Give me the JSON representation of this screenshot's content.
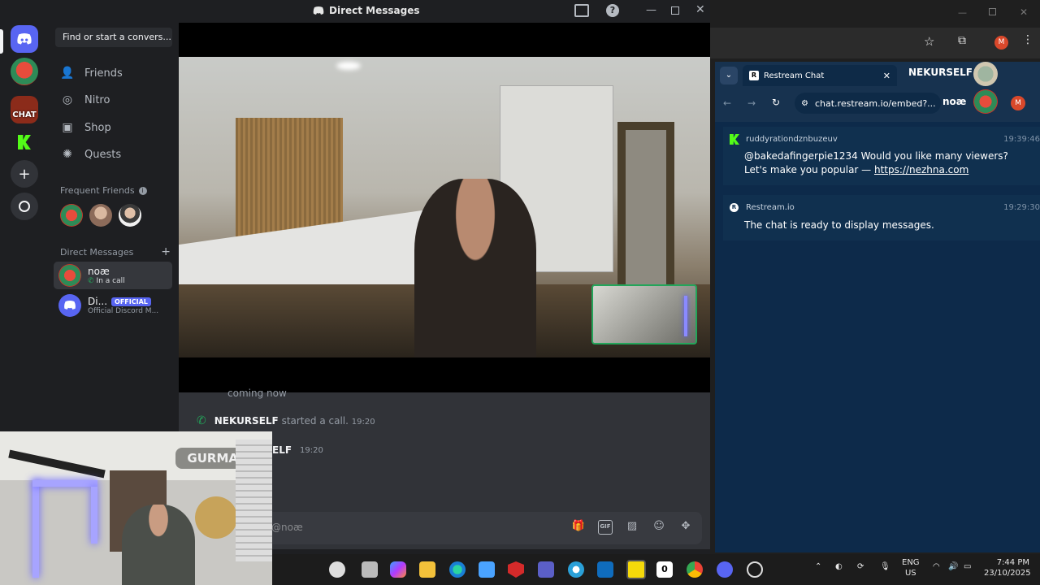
{
  "discord": {
    "window_title": "Direct Messages",
    "search_placeholder": "Find or start a convers...",
    "nav": [
      {
        "label": "Friends",
        "icon": "friends-icon"
      },
      {
        "label": "Nitro",
        "icon": "nitro-icon"
      },
      {
        "label": "Shop",
        "icon": "shop-icon"
      },
      {
        "label": "Quests",
        "icon": "quests-icon"
      }
    ],
    "frequent_friends_label": "Frequent Friends",
    "direct_messages_label": "Direct Messages",
    "dms": [
      {
        "name": "noæ",
        "status": "In a call"
      },
      {
        "name": "Di...",
        "badge": "OFFICIAL",
        "status": "Official Discord M..."
      }
    ],
    "server_label": "CHAT",
    "chat": {
      "partial_message": "coming now",
      "call_user": "NEKURSELF",
      "call_text": "started a call.",
      "call_time": "19:20",
      "partial_user": "ELF",
      "partial_time": "19:20"
    },
    "composer_placeholder": "@noæ",
    "webcam_sign": "GURMAN"
  },
  "browser": {
    "tab_title": "Restream Chat",
    "overlay_name": "NEKURSELF",
    "url": "chat.restream.io/embed?...",
    "overlay_name2": "noæ",
    "profile_initial": "M",
    "messages": [
      {
        "user": "ruddyrationdznbuzeuv",
        "time": "19:39:46",
        "text_plain": "@bakedafingerpie1234 Would you like many viewers? Let's make you popular — ",
        "link": "https://nezhna.com"
      },
      {
        "user": "Restream.io",
        "time": "19:29:30",
        "text_plain": "The chat is ready to display messages."
      }
    ]
  },
  "taskbar": {
    "lang": "ENG",
    "region": "US",
    "time": "7:44 PM",
    "date": "23/10/2025"
  },
  "colors": {
    "discord_blurple": "#5865f2",
    "green": "#23a55a",
    "restream_bg": "#0d2a4a",
    "kick_green": "#53fc18"
  }
}
